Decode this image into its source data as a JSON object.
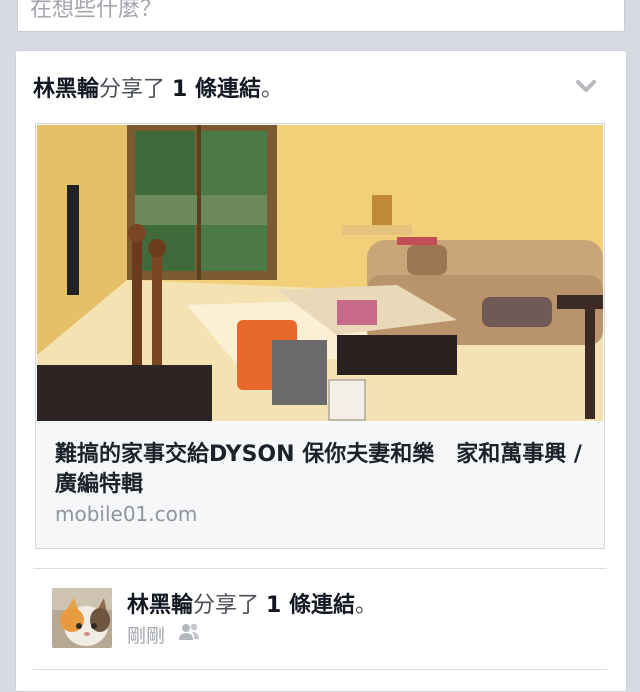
{
  "composer": {
    "placeholder": "在想些什麼？"
  },
  "story": {
    "author": "林黑輪",
    "action_prefix": "分享了",
    "count": "1 條連結",
    "period": "。",
    "menu_icon": "chevron-down-icon"
  },
  "link": {
    "image_icon": "living-room-photo",
    "title": "難搞的家事交給DYSON 保你夫妻和樂　家和萬事興 / 廣編特輯",
    "domain": "mobile01.com"
  },
  "sub_story": {
    "author": "林黑輪",
    "action_prefix": "分享了",
    "count": "1 條連結",
    "period": "。",
    "timestamp": "剛剛",
    "privacy_icon": "friends-icon"
  },
  "colors": {
    "background": "#d7dae0",
    "card": "#ffffff",
    "text_dark": "#141823",
    "text_muted": "#90949c"
  }
}
